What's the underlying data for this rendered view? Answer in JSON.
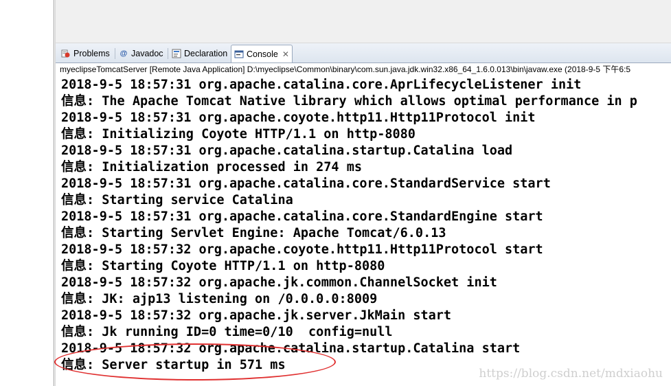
{
  "tabs": [
    {
      "label": "Problems",
      "icon": "problems-icon"
    },
    {
      "label": "Javadoc",
      "icon": "at-icon"
    },
    {
      "label": "Declaration",
      "icon": "declaration-icon"
    },
    {
      "label": "Console",
      "icon": "console-icon",
      "active": true
    }
  ],
  "console": {
    "header": "myeclipseTomcatServer [Remote Java Application] D:\\myeclipse\\Common\\binary\\com.sun.java.jdk.win32.x86_64_1.6.0.013\\bin\\javaw.exe (2018-9-5 下午6:5",
    "lines": [
      "2018-9-5 18:57:31 org.apache.catalina.core.AprLifecycleListener init",
      "信息: The Apache Tomcat Native library which allows optimal performance in p",
      "2018-9-5 18:57:31 org.apache.coyote.http11.Http11Protocol init",
      "信息: Initializing Coyote HTTP/1.1 on http-8080",
      "2018-9-5 18:57:31 org.apache.catalina.startup.Catalina load",
      "信息: Initialization processed in 274 ms",
      "2018-9-5 18:57:31 org.apache.catalina.core.StandardService start",
      "信息: Starting service Catalina",
      "2018-9-5 18:57:31 org.apache.catalina.core.StandardEngine start",
      "信息: Starting Servlet Engine: Apache Tomcat/6.0.13",
      "2018-9-5 18:57:32 org.apache.coyote.http11.Http11Protocol start",
      "信息: Starting Coyote HTTP/1.1 on http-8080",
      "2018-9-5 18:57:32 org.apache.jk.common.ChannelSocket init",
      "信息: JK: ajp13 listening on /0.0.0.0:8009",
      "2018-9-5 18:57:32 org.apache.jk.server.JkMain start",
      "信息: Jk running ID=0 time=0/10  config=null",
      "2018-9-5 18:57:32 org.apache.catalina.startup.Catalina start",
      "信息: Server startup in 571 ms"
    ]
  },
  "watermark": "https://blog.csdn.net/mdxiaohu",
  "colors": {
    "annotation": "#e03030"
  }
}
